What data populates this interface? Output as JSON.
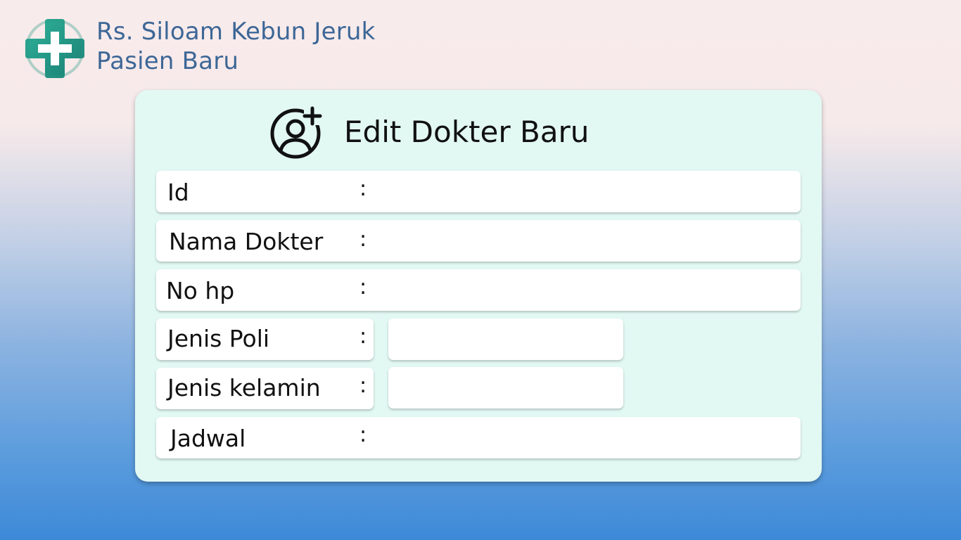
{
  "header": {
    "hospital_name": "Rs. Siloam Kebun Jeruk",
    "page_subtitle": "Pasien Baru",
    "logo_icon": "medical-cross-icon",
    "logo_colors": [
      "#1f9e8c",
      "#2d9d8c",
      "#1b7a73"
    ]
  },
  "form": {
    "title": "Edit Dokter Baru",
    "title_icon": "add-user-icon",
    "fields": {
      "id": {
        "label": "Id",
        "colon": ":",
        "value": ""
      },
      "nama_dokter": {
        "label": "Nama Dokter",
        "colon": ":",
        "value": ""
      },
      "no_hp": {
        "label": "No hp",
        "colon": ":",
        "value": ""
      },
      "jenis_poli": {
        "label": "Jenis Poli",
        "colon": ":",
        "value": ""
      },
      "jenis_kelamin": {
        "label": "Jenis kelamin",
        "colon": ":",
        "value": ""
      },
      "jadwal": {
        "label": "Jadwal",
        "colon": ":",
        "value": ""
      }
    }
  },
  "colors": {
    "card_background": "#e2f8f3",
    "header_text": "#3d6797",
    "field_background": "#ffffff"
  }
}
